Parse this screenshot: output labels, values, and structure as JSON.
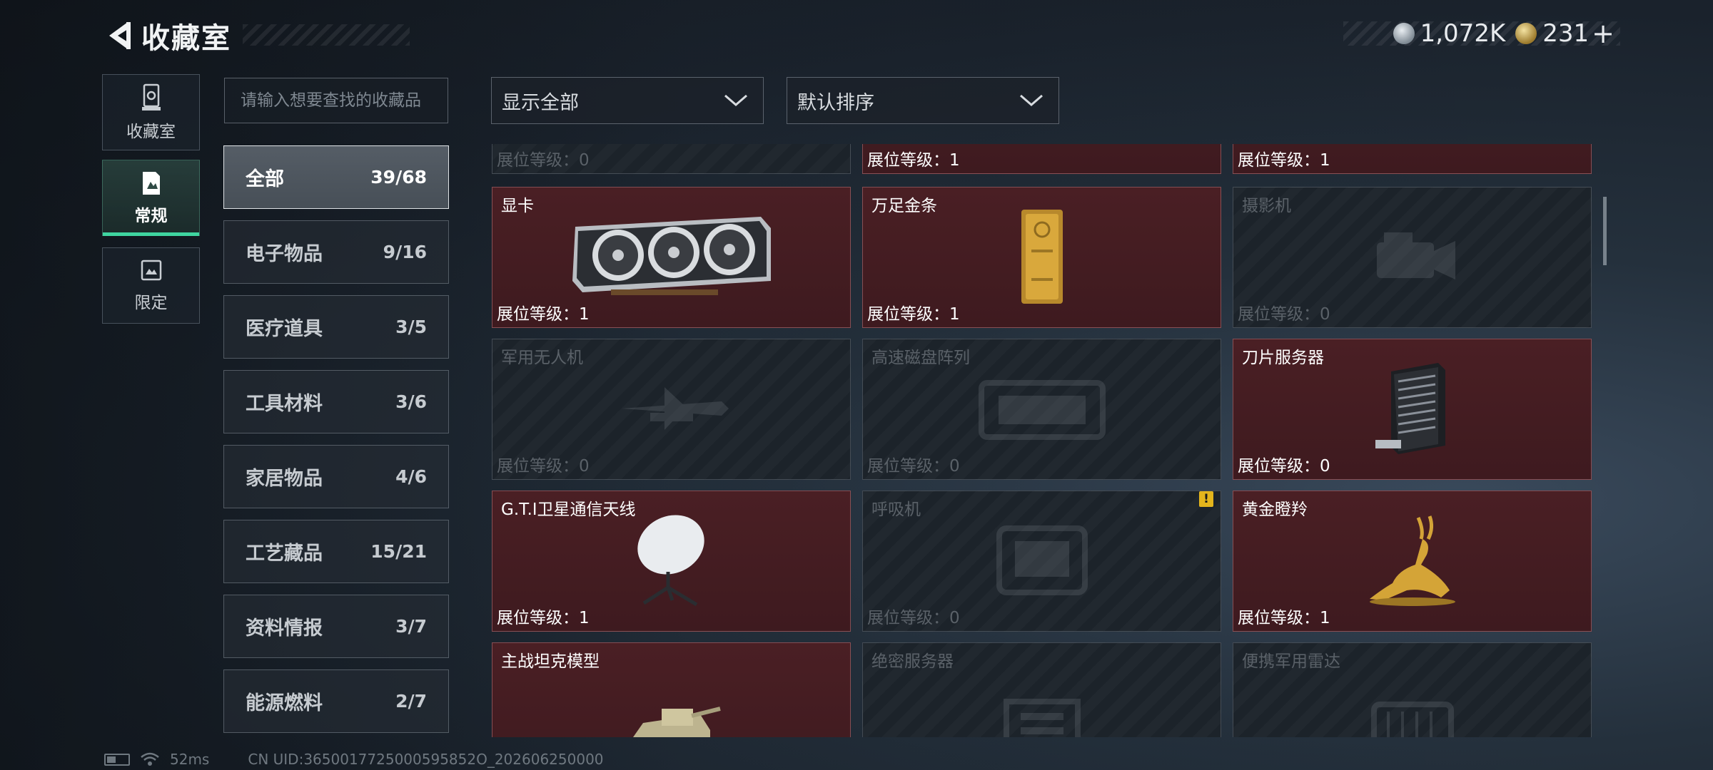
{
  "header": {
    "title": "收藏室"
  },
  "currency": {
    "silver": "1,072K",
    "gold": "231",
    "plus": "+"
  },
  "side_tabs": [
    {
      "label": "收藏室",
      "icon": "collection-room-icon"
    },
    {
      "label": "常规",
      "icon": "regular-icon",
      "active": true
    },
    {
      "label": "限定",
      "icon": "limited-icon"
    }
  ],
  "search": {
    "placeholder": "请输入想要查找的收藏品"
  },
  "categories": [
    {
      "name": "全部",
      "count": "39/68",
      "active": true
    },
    {
      "name": "电子物品",
      "count": "9/16"
    },
    {
      "name": "医疗道具",
      "count": "3/5"
    },
    {
      "name": "工具材料",
      "count": "3/6"
    },
    {
      "name": "家居物品",
      "count": "4/6"
    },
    {
      "name": "工艺藏品",
      "count": "15/21"
    },
    {
      "name": "资料情报",
      "count": "3/7"
    },
    {
      "name": "能源燃料",
      "count": "2/7"
    }
  ],
  "filters": {
    "display": "显示全部",
    "sort": "默认排序"
  },
  "level_prefix": "展位等级：",
  "items": [
    {
      "name": "",
      "level": "展位等级：0",
      "owned": false
    },
    {
      "name": "",
      "level": "展位等级：1",
      "owned": true
    },
    {
      "name": "",
      "level": "展位等级：1",
      "owned": true
    },
    {
      "name": "显卡",
      "level": "展位等级：1",
      "owned": true,
      "icon": "gpu-icon"
    },
    {
      "name": "万足金条",
      "level": "展位等级：1",
      "owned": true,
      "icon": "gold-bar-icon"
    },
    {
      "name": "摄影机",
      "level": "展位等级：0",
      "owned": false,
      "icon": "camera-icon"
    },
    {
      "name": "军用无人机",
      "level": "展位等级：0",
      "owned": false,
      "icon": "drone-icon"
    },
    {
      "name": "高速磁盘阵列",
      "level": "展位等级：0",
      "owned": false,
      "icon": "disk-array-icon"
    },
    {
      "name": "刀片服务器",
      "level": "展位等级：0",
      "owned": true,
      "icon": "blade-server-icon"
    },
    {
      "name": "G.T.I卫星通信天线",
      "level": "展位等级：1",
      "owned": true,
      "icon": "satellite-dish-icon"
    },
    {
      "name": "呼吸机",
      "level": "展位等级：0",
      "owned": false,
      "icon": "ventilator-icon",
      "warning": "!"
    },
    {
      "name": "黄金瞪羚",
      "level": "展位等级：1",
      "owned": true,
      "icon": "golden-gazelle-icon"
    },
    {
      "name": "主战坦克模型",
      "level": "",
      "owned": true,
      "icon": "tank-model-icon"
    },
    {
      "name": "绝密服务器",
      "level": "",
      "owned": false,
      "icon": "secret-server-icon"
    },
    {
      "name": "便携军用雷达",
      "level": "",
      "owned": false,
      "icon": "portable-radar-icon"
    }
  ],
  "footer": {
    "ping": "52ms",
    "uid": "CN UID:3650017725000595852O_202606250000"
  }
}
